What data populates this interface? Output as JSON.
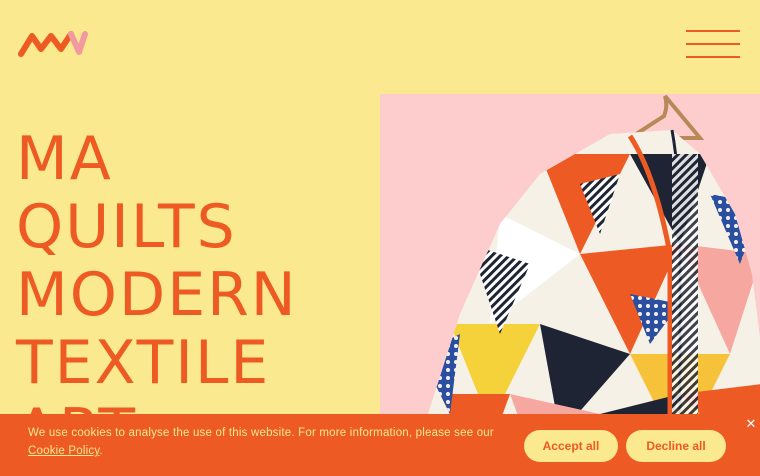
{
  "header": {
    "logo_icon": "ma-logo-icon",
    "menu_icon": "hamburger-menu-icon"
  },
  "hero": {
    "title_lines": [
      "MA",
      "QUILTS",
      "MODERN",
      "TEXTILE",
      "ART"
    ]
  },
  "image": {
    "subject": "patchwork-quilted-jacket-photo"
  },
  "cookie_banner": {
    "text_before_link": "We use cookies to analyse the use of this website. For more information, please see our ",
    "link_label": "Cookie Policy",
    "text_after_link": ".",
    "accept_label": "Accept all",
    "decline_label": "Decline all",
    "close_glyph": "✕"
  },
  "colors": {
    "background": "#fbe98f",
    "accent": "#ee5a24",
    "image_background": "#fdcdcd"
  }
}
